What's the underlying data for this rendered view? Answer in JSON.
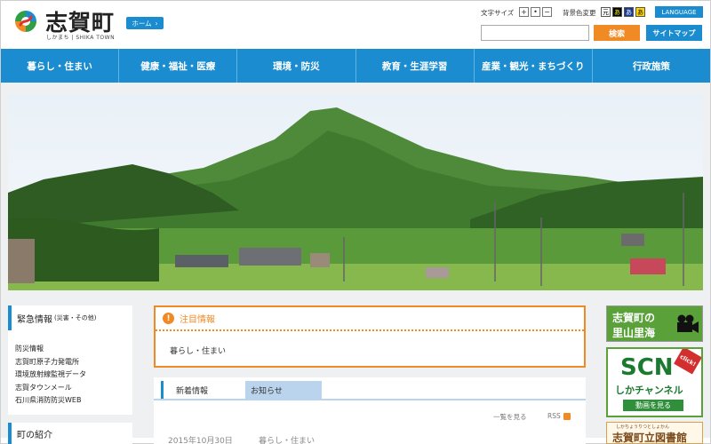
{
  "header": {
    "logo_text": "志賀町",
    "logo_sub": "しかまち | SHIKA TOWN",
    "home_label": "ホーム",
    "text_size_label": "文字サイズ",
    "text_size_buttons": [
      "+",
      "•",
      "−"
    ],
    "bg_color_label": "背景色変更",
    "bg_color_buttons": [
      "元",
      "あ",
      "あ",
      "あ"
    ],
    "language_label": "LANGUAGE",
    "search_placeholder": "",
    "search_label": "検索",
    "sitemap_label": "サイトマップ"
  },
  "nav": {
    "items": [
      "暮らし・住まい",
      "健康・福祉・医療",
      "環境・防災",
      "教育・生涯学習",
      "産業・観光・まちづくり",
      "行政施策"
    ]
  },
  "sidebar": {
    "emergency_title": "緊急情報",
    "emergency_sub": "(災害・その他)",
    "links": [
      "防災情報",
      "志賀町原子力発電所",
      "環境放射線監視データ",
      "志賀タウンメール",
      "石川県消防防災WEB"
    ],
    "intro_title": "町の紹介"
  },
  "notice": {
    "title": "注目情報",
    "icon": "!",
    "body": "暮らし・住まい"
  },
  "news": {
    "tab_new": "新着情報",
    "tab_notice": "お知らせ",
    "list_link": "一覧を見る",
    "rss_label": "RSS",
    "items": [
      {
        "date": "2015年10月30日",
        "category": "暮らし・住まい"
      }
    ]
  },
  "banners": {
    "satoyama_line1": "志賀町の",
    "satoyama_line2": "里山里海",
    "scn_logo": "SCN",
    "scn_channel": "しかチャンネル",
    "scn_watch": "動画を見る",
    "scn_click": "click!",
    "library_ruby": "しかちょうりつとしょかん",
    "library_name": "志賀町立図書館"
  },
  "colors": {
    "primary": "#1a8ccf",
    "accent": "#f08a24",
    "green": "#5aa13a"
  }
}
